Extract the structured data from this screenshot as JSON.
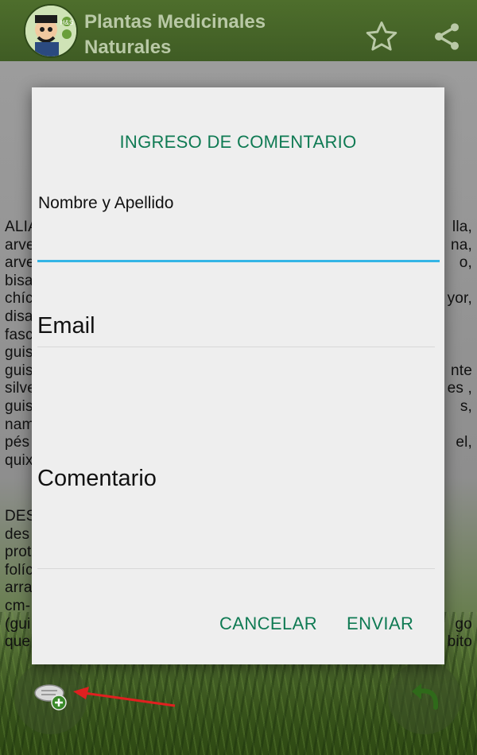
{
  "app_bar": {
    "title": "Plantas Medicinales Naturales",
    "title_line1": "Plantas Medicinales",
    "title_line2": "Naturales",
    "avatar_icon": "herbalist-avatar-icon",
    "avatar_badge": "H&S",
    "actions": [
      "star-icon",
      "share-icon"
    ]
  },
  "background_text": {
    "para1_lines": [
      [
        "ALIA",
        "lla,"
      ],
      [
        "arve",
        "na,"
      ],
      [
        "arve",
        "o,"
      ],
      [
        "bisa",
        ""
      ],
      [
        "chíc",
        "yor,"
      ],
      [
        "disa",
        ""
      ],
      [
        "fasc",
        ""
      ],
      [
        "guis",
        ""
      ],
      [
        "guis",
        "nte"
      ],
      [
        "silve",
        "es ,"
      ],
      [
        "guis",
        "s,"
      ],
      [
        "nam",
        ""
      ],
      [
        "pés",
        "el,"
      ],
      [
        "quix",
        ""
      ]
    ],
    "para2_lines": [
      [
        "DES",
        ""
      ],
      [
        "des",
        ""
      ],
      [
        "prot",
        ""
      ],
      [
        "folíc",
        ""
      ],
      [
        "arra",
        ""
      ],
      [
        "cm-",
        ""
      ],
      [
        "(gui",
        "go"
      ],
      [
        "que",
        "bito"
      ]
    ]
  },
  "dialog": {
    "title": "INGRESO DE COMENTARIO",
    "name_label": "Nombre y Apellido",
    "name_value": "",
    "email_placeholder": "Email",
    "comment_placeholder": "Comentario",
    "cancel_label": "CANCELAR",
    "send_label": "ENVIAR"
  },
  "bottom": {
    "left_fab_icon": "add-comment-icon",
    "right_fab_icon": "back-arrow-icon"
  },
  "colors": {
    "accent_green": "#0f7a53",
    "focus_blue": "#33b5e5",
    "appbar_green": "#4e6e2c",
    "annotation_red": "#e02020"
  }
}
